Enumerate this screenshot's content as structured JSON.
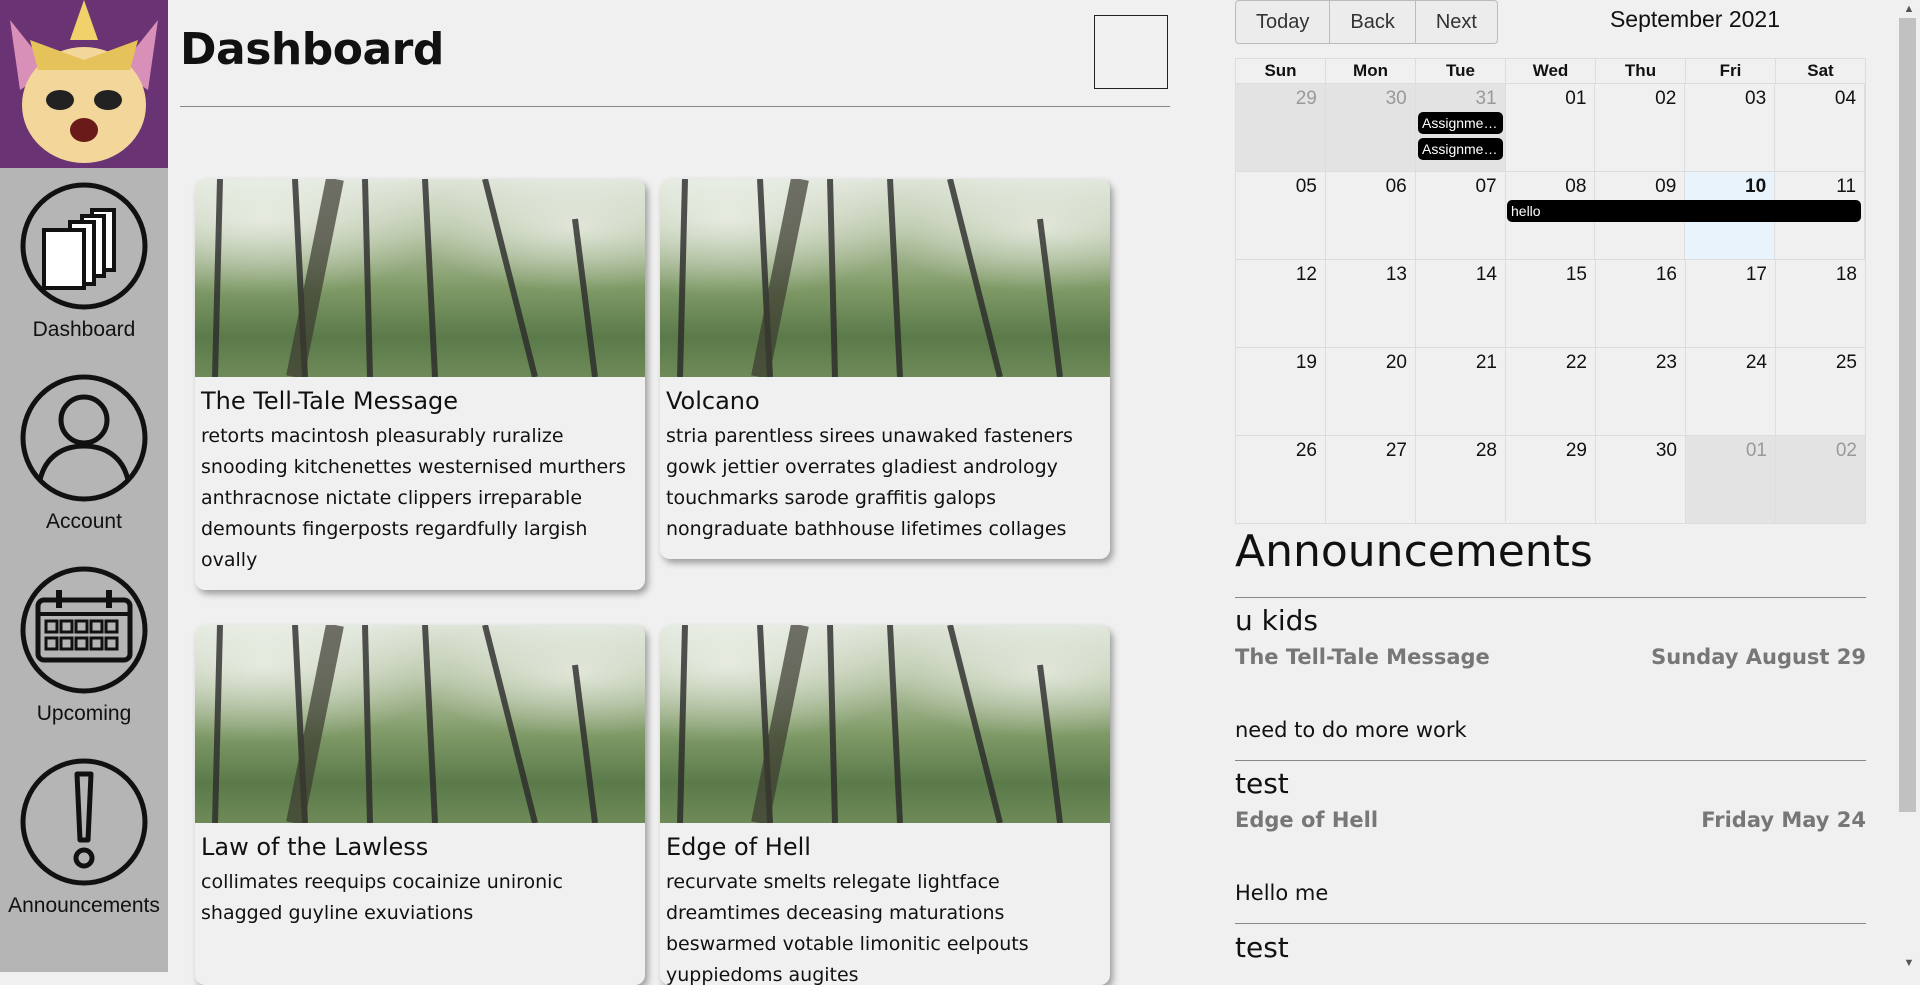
{
  "sidebar": {
    "items": [
      {
        "label": "Dashboard",
        "icon": "stacked-cards-icon"
      },
      {
        "label": "Account",
        "icon": "user-icon"
      },
      {
        "label": "Upcoming",
        "icon": "calendar-icon"
      },
      {
        "label": "Announcements",
        "icon": "exclamation-icon"
      }
    ]
  },
  "header": {
    "title": "Dashboard"
  },
  "cards": [
    {
      "title": "The Tell-Tale Message",
      "desc": "retorts macintosh pleasurably ruralize snooding kitchenettes westernised murthers anthracnose nictate clippers irreparable demounts fingerposts regardfully largish ovally"
    },
    {
      "title": "Volcano",
      "desc": "stria parentless sirees unawaked fasteners gowk jettier overrates gladiest andrology touchmarks sarode graffitis galops nongraduate bathhouse lifetimes collages"
    },
    {
      "title": "Law of the Lawless",
      "desc": "collimates reequips cocainize unironic shagged guyline exuviations"
    },
    {
      "title": "Edge of Hell",
      "desc": "recurvate smelts relegate lightface dreamtimes deceasing maturations beswarmed votable limonitic eelpouts yuppiedoms augites"
    }
  ],
  "calendar": {
    "buttons": {
      "today": "Today",
      "back": "Back",
      "next": "Next"
    },
    "month_label": "September 2021",
    "weekdays": [
      "Sun",
      "Mon",
      "Tue",
      "Wed",
      "Thu",
      "Fri",
      "Sat"
    ],
    "weeks": [
      [
        "29",
        "30",
        "31",
        "01",
        "02",
        "03",
        "04"
      ],
      [
        "05",
        "06",
        "07",
        "08",
        "09",
        "10",
        "11"
      ],
      [
        "12",
        "13",
        "14",
        "15",
        "16",
        "17",
        "18"
      ],
      [
        "19",
        "20",
        "21",
        "22",
        "23",
        "24",
        "25"
      ],
      [
        "26",
        "27",
        "28",
        "29",
        "30",
        "01",
        "02"
      ]
    ],
    "events": {
      "assignment1": "Assignment...",
      "assignment2": "Assignment...",
      "hello": "hello"
    }
  },
  "announcements": {
    "title": "Announcements",
    "items": [
      {
        "heading": "u kids",
        "course": "The Tell-Tale Message",
        "date": "Sunday August 29",
        "body": "need to do more work"
      },
      {
        "heading": "test",
        "course": "Edge of Hell",
        "date": "Friday May 24",
        "body": "Hello me"
      },
      {
        "heading": "test"
      }
    ]
  }
}
